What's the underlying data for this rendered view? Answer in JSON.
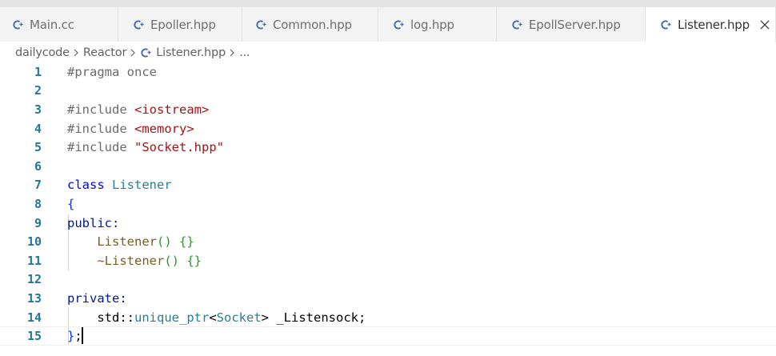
{
  "tabs": [
    {
      "label": "Main.cc",
      "active": false
    },
    {
      "label": "Epoller.hpp",
      "active": false
    },
    {
      "label": "Common.hpp",
      "active": false
    },
    {
      "label": "log.hpp",
      "active": false
    },
    {
      "label": "EpollServer.hpp",
      "active": false
    },
    {
      "label": "Listener.hpp",
      "active": true
    }
  ],
  "breadcrumb": {
    "items": [
      "dailycode",
      "Reactor",
      "Listener.hpp",
      "..."
    ]
  },
  "icons": {
    "file": "cpp-file-icon",
    "close": "close-icon",
    "separator": "chevron-right-icon"
  },
  "colors": {
    "cpp_icon": "#4b6ea8",
    "line_number": "#237893",
    "keyword": "#0000ff",
    "string": "#a31515",
    "type": "#267f99",
    "function": "#795e26"
  },
  "editor": {
    "lines": [
      {
        "num": "1",
        "tokens": [
          [
            "#pragma once",
            "t-pre"
          ]
        ]
      },
      {
        "num": "2",
        "tokens": []
      },
      {
        "num": "3",
        "tokens": [
          [
            "#include ",
            "t-pre"
          ],
          [
            "<iostream>",
            "t-str"
          ]
        ]
      },
      {
        "num": "4",
        "tokens": [
          [
            "#include ",
            "t-pre"
          ],
          [
            "<memory>",
            "t-str"
          ]
        ]
      },
      {
        "num": "5",
        "tokens": [
          [
            "#include ",
            "t-pre"
          ],
          [
            "\"Socket.hpp\"",
            "t-str"
          ]
        ]
      },
      {
        "num": "6",
        "tokens": []
      },
      {
        "num": "7",
        "tokens": [
          [
            "class",
            "t-kw"
          ],
          [
            " ",
            "t-plain"
          ],
          [
            "Listener",
            "t-type"
          ]
        ]
      },
      {
        "num": "8",
        "tokens": [
          [
            "{",
            "t-br1"
          ]
        ]
      },
      {
        "num": "9",
        "tokens": [
          [
            "public:",
            "t-key"
          ]
        ]
      },
      {
        "num": "10",
        "tokens": [
          [
            "    ",
            "t-plain"
          ],
          [
            "Listener",
            "t-fn"
          ],
          [
            "()",
            "t-br2"
          ],
          [
            " ",
            "t-plain"
          ],
          [
            "{}",
            "t-br2"
          ]
        ]
      },
      {
        "num": "11",
        "tokens": [
          [
            "    ",
            "t-plain"
          ],
          [
            "~Listener",
            "t-fn"
          ],
          [
            "()",
            "t-br2"
          ],
          [
            " ",
            "t-plain"
          ],
          [
            "{}",
            "t-br2"
          ]
        ]
      },
      {
        "num": "12",
        "tokens": []
      },
      {
        "num": "13",
        "tokens": [
          [
            "private:",
            "t-key"
          ]
        ]
      },
      {
        "num": "14",
        "tokens": [
          [
            "    ",
            "t-plain"
          ],
          [
            "std",
            "t-plain"
          ],
          [
            "::",
            "t-plain"
          ],
          [
            "unique_ptr",
            "t-type"
          ],
          [
            "<",
            "t-plain"
          ],
          [
            "Socket",
            "t-type"
          ],
          [
            "> _Listensock;",
            "t-plain"
          ]
        ]
      },
      {
        "num": "15",
        "tokens": [
          [
            "}",
            "t-br1"
          ],
          [
            ";",
            "t-plain"
          ]
        ]
      }
    ]
  }
}
